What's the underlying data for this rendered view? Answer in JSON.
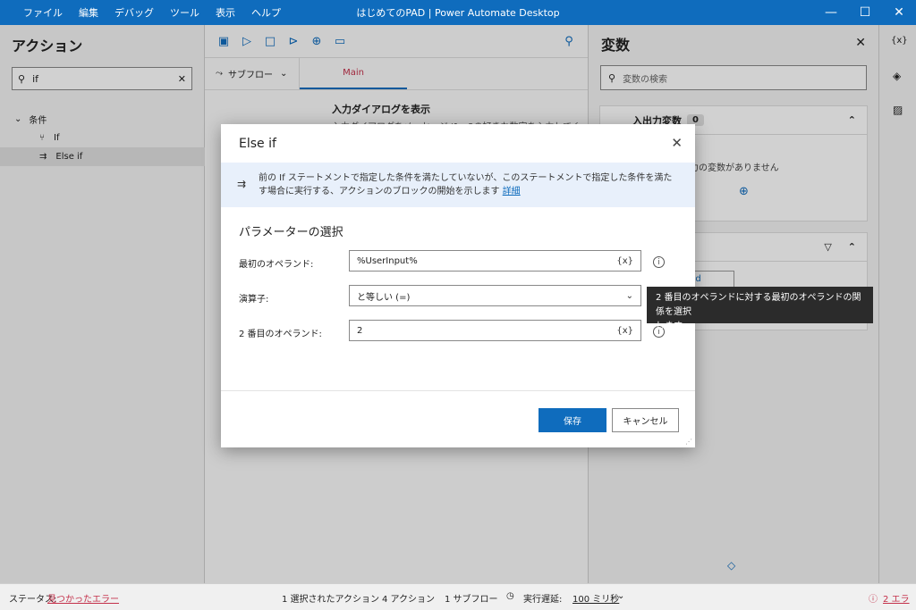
{
  "window": {
    "title": "はじめてのPAD | Power Automate Desktop",
    "menu": [
      "ファイル",
      "編集",
      "デバッグ",
      "ツール",
      "表示",
      "ヘルプ"
    ]
  },
  "actions_pane": {
    "title": "アクション",
    "search_value": "if",
    "tree": {
      "group": "条件",
      "items": [
        "If",
        "Else if"
      ]
    }
  },
  "designer": {
    "subflow_label": "サブフロー",
    "main_tab": "Main",
    "step_title": "入力ダイアログを表示",
    "step_desc": "入力ダイアログをメッセージ '1～3の好きな数字を入力してく"
  },
  "variables_pane": {
    "title": "変数",
    "search_placeholder": "変数の検索",
    "io_header": "入出力変数",
    "io_count": "0",
    "io_empty": "入力または出力の変数がありません",
    "flow_tab_partial": "sed"
  },
  "dialog": {
    "title": "Else if",
    "info_text": "前の If ステートメントで指定した条件を満たしていないが、このステートメントで指定した条件を満たす場合に実行する、アクションのブロックの開始を示します",
    "info_link": "詳細",
    "section_title": "パラメーターの選択",
    "params": [
      {
        "label": "最初のオペランド:",
        "value": "%UserInput%"
      },
      {
        "label": "演算子:",
        "value": "と等しい (=)"
      },
      {
        "label": "2 番目のオペランド:",
        "value": "2"
      }
    ],
    "var_button": "{x}",
    "save_label": "保存",
    "cancel_label": "キャンセル"
  },
  "tooltip": {
    "line1": "2 番目のオペランドに対する最初のオペランドの関係を選択",
    "line2": "します。"
  },
  "status": {
    "label": "ステータス:",
    "value": "見つかったエラー",
    "selected_actions": "1 選択されたアクション",
    "action_count": "4 アクション",
    "subflow_count": "1 サブフロー",
    "delay_label": "実行遅延:",
    "delay_value": "100 ミリ秒",
    "errors": "2 エラー"
  },
  "colors": {
    "accent": "#0f6cbd",
    "error": "#c4314b"
  }
}
